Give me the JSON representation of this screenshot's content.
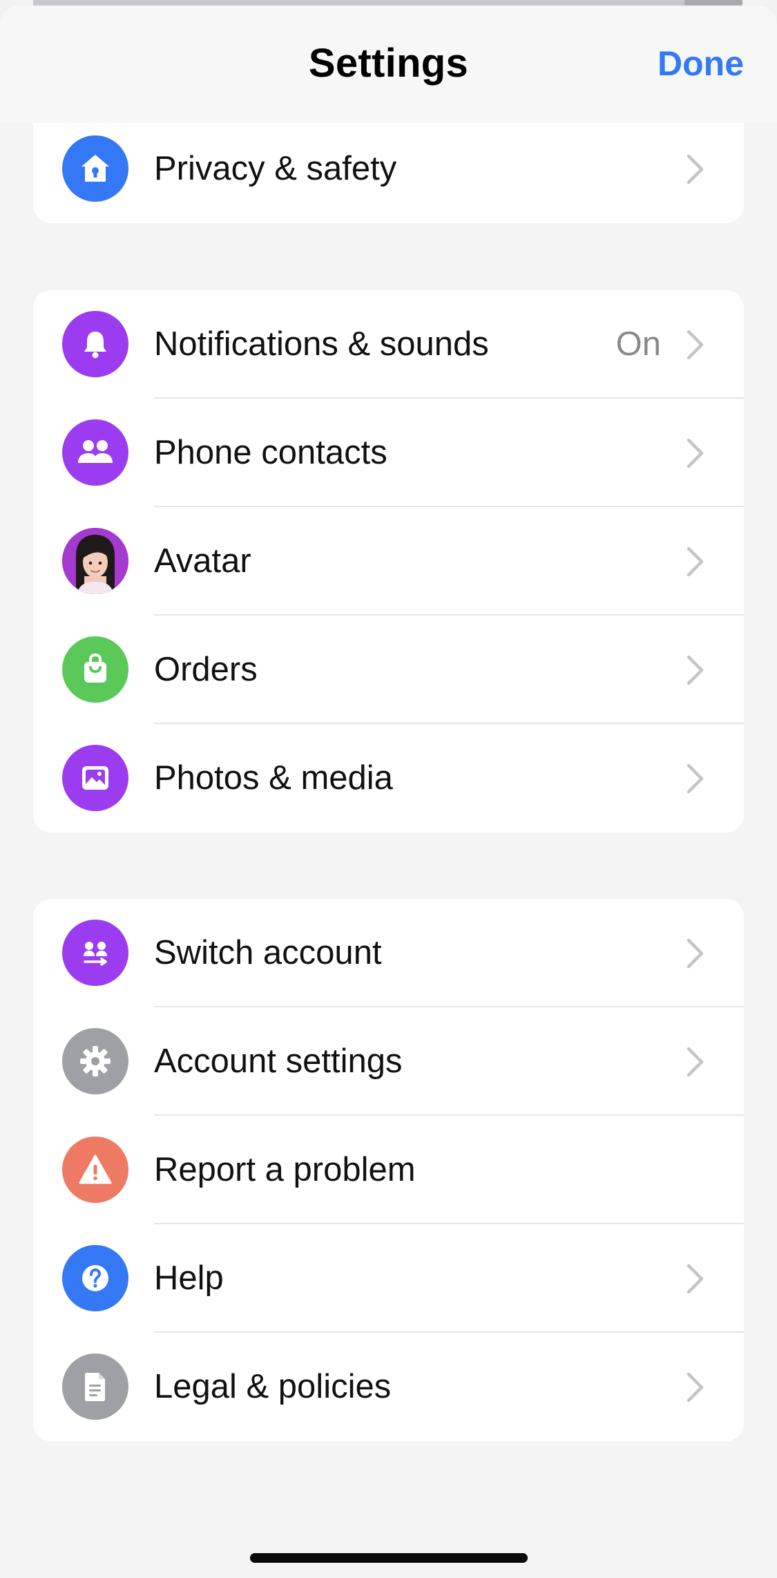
{
  "header": {
    "title": "Settings",
    "done_label": "Done"
  },
  "colors": {
    "accent_blue": "#3478f6",
    "purple": "#9b3cf0",
    "green": "#5ac95a",
    "gray": "#9fa0a5",
    "red": "#ee7a63"
  },
  "section1": {
    "items": [
      {
        "label": "Privacy & safety",
        "icon": "house-lock-icon"
      }
    ]
  },
  "section2": {
    "items": [
      {
        "label": "Notifications & sounds",
        "value": "On",
        "icon": "bell-icon"
      },
      {
        "label": "Phone contacts",
        "icon": "people-icon"
      },
      {
        "label": "Avatar",
        "icon": "avatar-image"
      },
      {
        "label": "Orders",
        "icon": "shopping-bag-icon"
      },
      {
        "label": "Photos & media",
        "icon": "photo-icon"
      }
    ]
  },
  "section3": {
    "items": [
      {
        "label": "Switch account",
        "icon": "switch-account-icon"
      },
      {
        "label": "Account settings",
        "icon": "gear-icon"
      },
      {
        "label": "Report a problem",
        "icon": "warning-icon"
      },
      {
        "label": "Help",
        "icon": "question-icon"
      },
      {
        "label": "Legal & policies",
        "icon": "document-icon"
      }
    ]
  }
}
